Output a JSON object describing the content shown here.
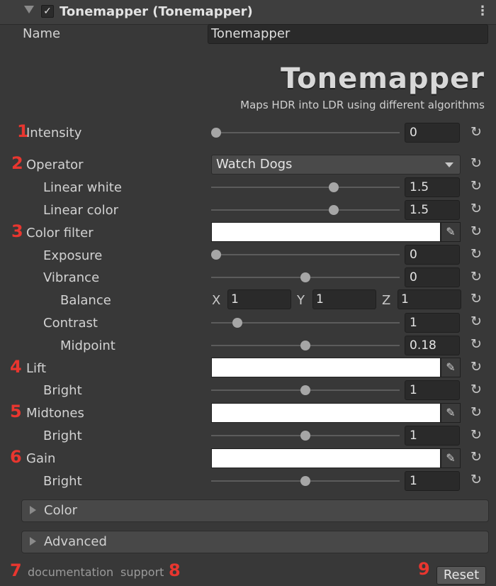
{
  "header": {
    "title": "Tonemapper (Tonemapper)",
    "enabled": true
  },
  "name_row": {
    "label": "Name",
    "value": "Tonemapper"
  },
  "logo": {
    "text": "Tonemapper",
    "subtitle": "Maps HDR into LDR using different algorithms"
  },
  "markers": [
    "1",
    "2",
    "3",
    "4",
    "5",
    "6",
    "7",
    "8",
    "9"
  ],
  "rows": {
    "intensity": {
      "label": "Intensity",
      "value": "0",
      "fraction": 0.0
    },
    "operator": {
      "label": "Operator",
      "selected": "Watch Dogs"
    },
    "linear_white": {
      "label": "Linear white",
      "value": "1.5",
      "fraction": 0.66
    },
    "linear_color": {
      "label": "Linear color",
      "value": "1.5",
      "fraction": 0.66
    },
    "color_filter": {
      "label": "Color filter",
      "color": "#ffffff"
    },
    "exposure": {
      "label": "Exposure",
      "value": "0",
      "fraction": 0.0
    },
    "vibrance": {
      "label": "Vibrance",
      "value": "0",
      "fraction": 0.5
    },
    "balance": {
      "label": "Balance",
      "x_label": "X",
      "x": "1",
      "y_label": "Y",
      "y": "1",
      "z_label": "Z",
      "z": "1"
    },
    "contrast": {
      "label": "Contrast",
      "value": "1",
      "fraction": 0.12
    },
    "midpoint": {
      "label": "Midpoint",
      "value": "0.18",
      "fraction": 0.5
    },
    "lift": {
      "label": "Lift",
      "color": "#ffffff"
    },
    "lift_bright": {
      "label": "Bright",
      "value": "1",
      "fraction": 0.5
    },
    "midtones": {
      "label": "Midtones",
      "color": "#ffffff"
    },
    "midtones_bright": {
      "label": "Bright",
      "value": "1",
      "fraction": 0.5
    },
    "gain": {
      "label": "Gain",
      "color": "#ffffff"
    },
    "gain_bright": {
      "label": "Bright",
      "value": "1",
      "fraction": 0.5
    }
  },
  "sections": {
    "color": "Color",
    "advanced": "Advanced"
  },
  "footer": {
    "documentation": "documentation",
    "support": "support",
    "reset": "Reset"
  },
  "icons": {
    "reset": "refresh-icon",
    "eyedropper": "eyedropper-icon",
    "dropdown": "chevron-down-icon"
  },
  "colors": {
    "marker": "#e8362f",
    "background": "#383838"
  }
}
